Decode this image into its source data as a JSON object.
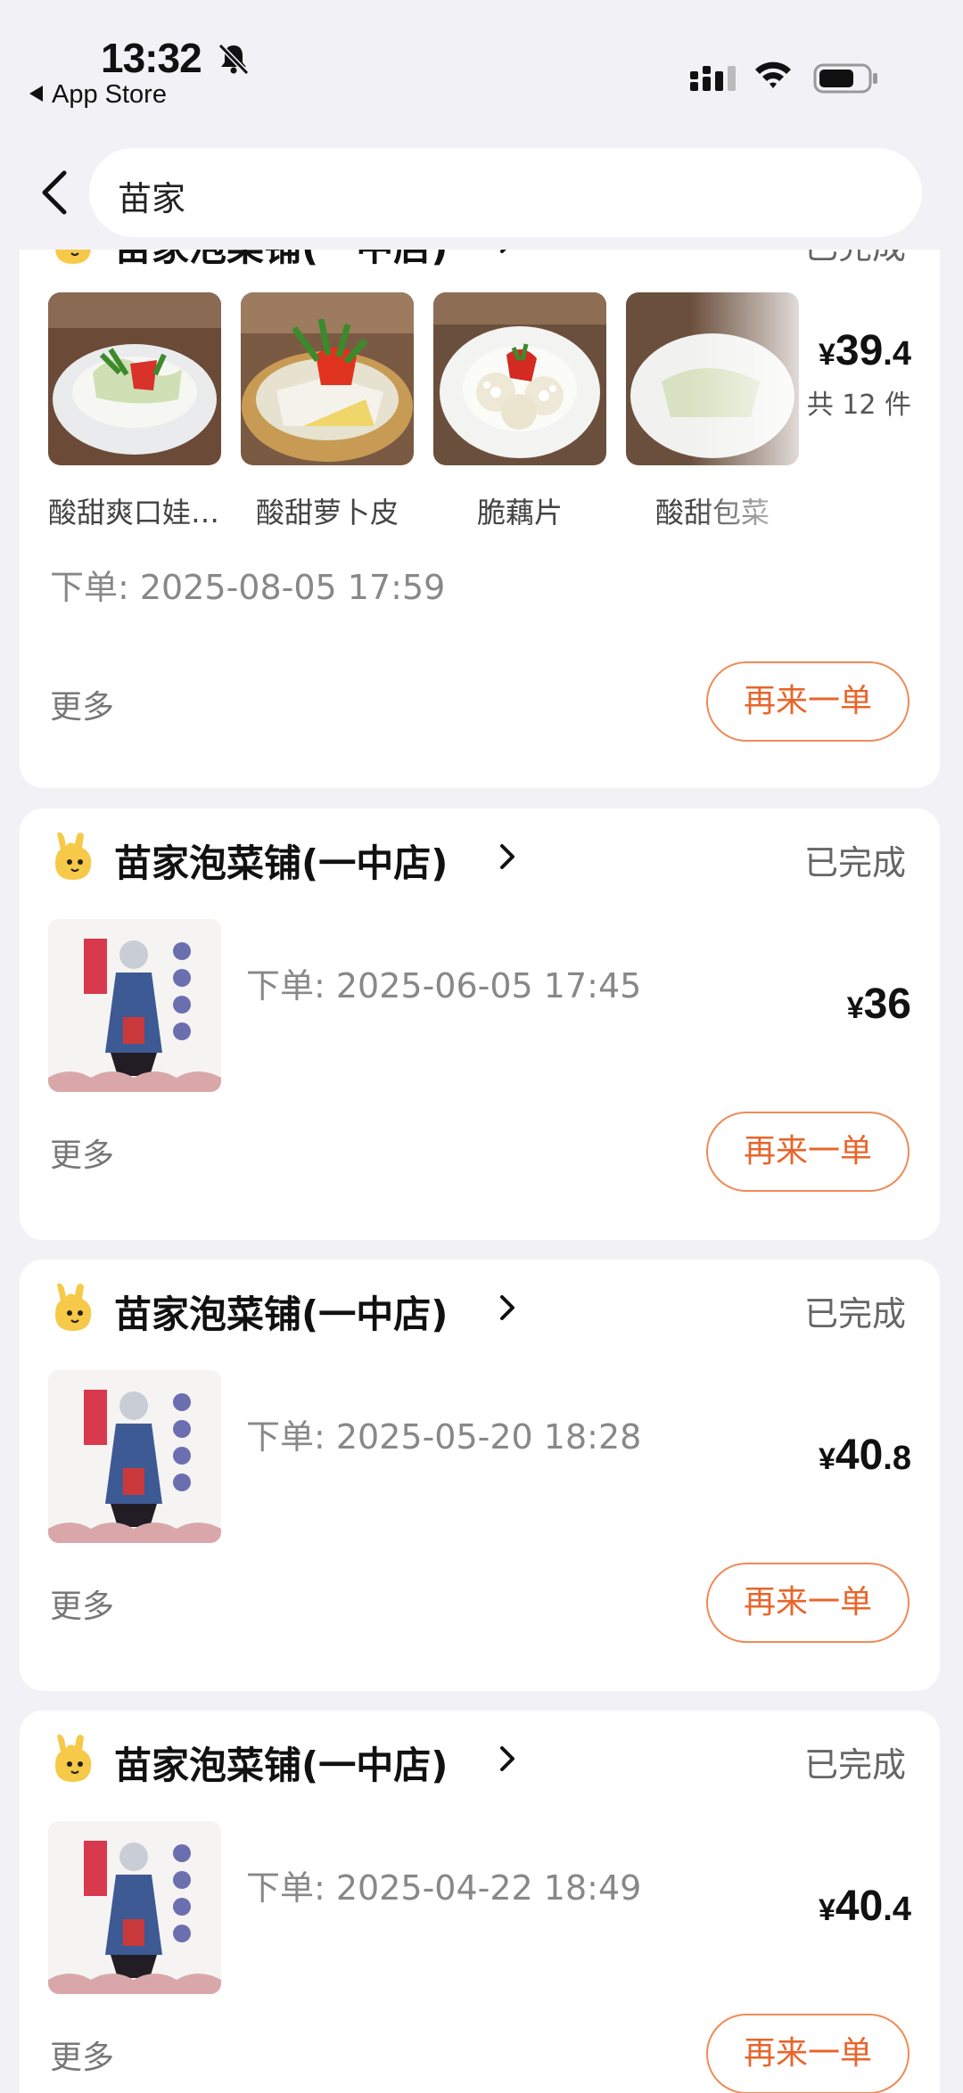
{
  "status_bar": {
    "time": "13:32",
    "back_app": "App Store",
    "icons": [
      "bell-muted-icon",
      "signal-icon",
      "wifi-icon",
      "battery-icon"
    ]
  },
  "search": {
    "query": "苗家"
  },
  "orders": [
    {
      "shop": "苗家泡菜铺(一中店)",
      "status": "已完成",
      "items": [
        "酸甜爽口娃娃菜",
        "酸甜萝卜皮",
        "脆藕片",
        "酸甜包菜"
      ],
      "price_currency": "¥",
      "price_int": "39",
      "price_dec": ".4",
      "count": "共 12 件",
      "order_time": "下单: 2025-08-05 17:59",
      "more": "更多",
      "reorder": "再来一单"
    },
    {
      "shop": "苗家泡菜铺(一中店)",
      "status": "已完成",
      "price_currency": "¥",
      "price_int": "36",
      "price_dec": "",
      "order_time": "下单: 2025-06-05 17:45",
      "more": "更多",
      "reorder": "再来一单"
    },
    {
      "shop": "苗家泡菜铺(一中店)",
      "status": "已完成",
      "price_currency": "¥",
      "price_int": "40",
      "price_dec": ".8",
      "order_time": "下单: 2025-05-20 18:28",
      "more": "更多",
      "reorder": "再来一单"
    },
    {
      "shop": "苗家泡菜铺(一中店)",
      "status": "已完成",
      "price_currency": "¥",
      "price_int": "40",
      "price_dec": ".4",
      "order_time": "下单: 2025-04-22 18:49",
      "more": "更多",
      "reorder": "再来一单"
    }
  ],
  "colors": {
    "accent": "#e8652b",
    "accent_border": "#ef8b57",
    "background": "#f2f2f6",
    "card": "#ffffff"
  }
}
